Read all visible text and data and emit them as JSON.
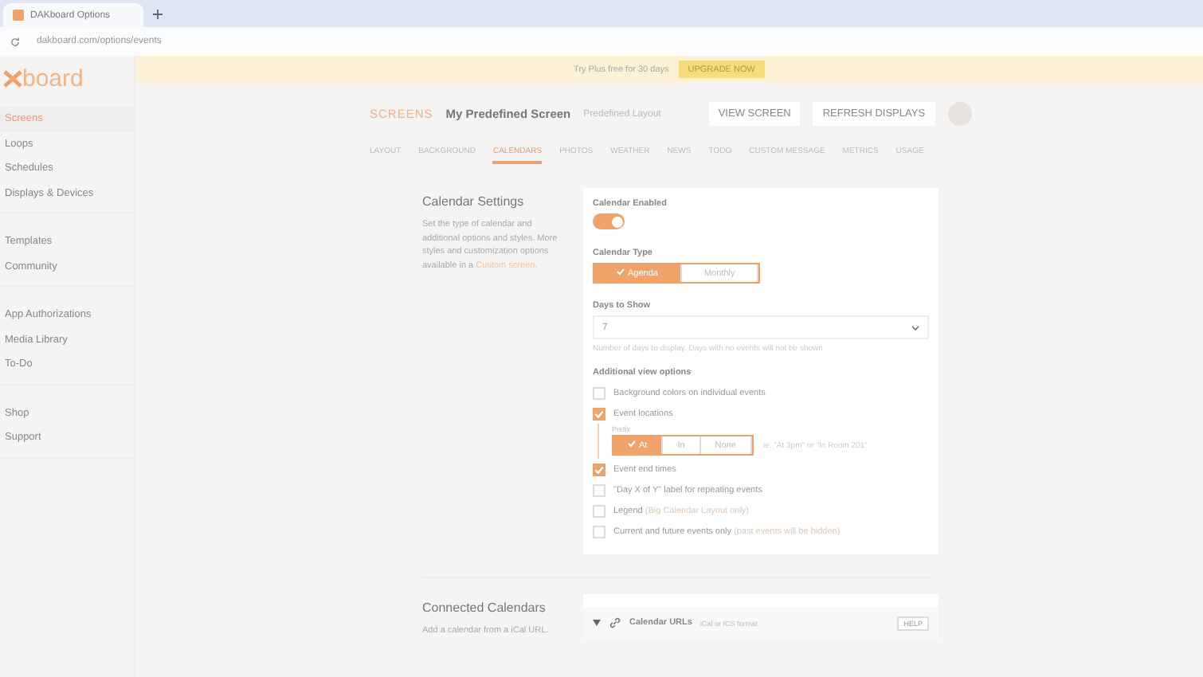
{
  "browser": {
    "tab_title": "DAKboard Options",
    "url": "dakboard.com/options/events"
  },
  "logo": "board",
  "sidebar": {
    "groups": [
      {
        "items": [
          {
            "label": "Screens",
            "selected": true
          },
          {
            "label": "Loops",
            "selected": false
          },
          {
            "label": "Schedules",
            "selected": false
          },
          {
            "label": "Displays & Devices",
            "selected": false
          }
        ]
      },
      {
        "items": [
          {
            "label": "Templates",
            "selected": false
          },
          {
            "label": "Community",
            "selected": false
          }
        ]
      },
      {
        "items": [
          {
            "label": "App Authorizations",
            "selected": false
          },
          {
            "label": "Media Library",
            "selected": false
          },
          {
            "label": "To-Do",
            "selected": false
          }
        ]
      },
      {
        "items": [
          {
            "label": "Shop",
            "selected": false
          },
          {
            "label": "Support",
            "selected": false
          }
        ]
      }
    ]
  },
  "banner": {
    "text": "Try Plus free for 30 days",
    "button": "UPGRADE NOW"
  },
  "header": {
    "section": "SCREENS",
    "title": "My Predefined Screen",
    "subtitle": "Predefined Layout",
    "buttons": [
      "VIEW SCREEN",
      "REFRESH DISPLAYS"
    ]
  },
  "tabs": [
    {
      "label": "LAYOUT",
      "selected": false
    },
    {
      "label": "BACKGROUND",
      "selected": false
    },
    {
      "label": "CALENDARS",
      "selected": true
    },
    {
      "label": "PHOTOS",
      "selected": false
    },
    {
      "label": "WEATHER",
      "selected": false
    },
    {
      "label": "NEWS",
      "selected": false
    },
    {
      "label": "TODO",
      "selected": false
    },
    {
      "label": "CUSTOM MESSAGE",
      "selected": false
    },
    {
      "label": "METRICS",
      "selected": false
    },
    {
      "label": "USAGE",
      "selected": false
    }
  ],
  "calendar_settings": {
    "title": "Calendar Settings",
    "description": "Set the type of calendar and additional options and styles. More styles and customization options available in a",
    "link": "Custom screen.",
    "enabled_label": "Calendar Enabled",
    "enabled": true,
    "type_label": "Calendar Type",
    "types": [
      {
        "label": "Agenda",
        "selected": true
      },
      {
        "label": "Monthly",
        "selected": false
      }
    ],
    "days_label": "Days to Show",
    "days_value": "7",
    "days_help": "Number of days to display. Days with no events will not be shown",
    "options_label": "Additional view options",
    "options": [
      {
        "label": "Background colors on individual events",
        "checked": false
      },
      {
        "label": "Event locations",
        "checked": true,
        "prefix_label": "Prefix",
        "prefixes": [
          {
            "label": "At",
            "selected": true
          },
          {
            "label": "In",
            "selected": false
          },
          {
            "label": "None",
            "selected": false
          }
        ],
        "prefix_hint": "ie. \"At 3pm\" or \"In Room 201\""
      },
      {
        "label": "Event end times",
        "checked": true
      },
      {
        "label": "\"Day X of Y\" label for repeating events",
        "checked": false
      },
      {
        "label": "Legend",
        "note": "(Big Calendar Layout only)",
        "checked": false
      },
      {
        "label": "Current and future events only",
        "note": "(past events will be hidden)",
        "checked": false
      }
    ]
  },
  "connected_calendars": {
    "title": "Connected Calendars",
    "description": "Add a calendar from a iCal URL.",
    "row_title": "Calendar URLs",
    "row_note": "iCal or ICS format",
    "help": "HELP"
  }
}
